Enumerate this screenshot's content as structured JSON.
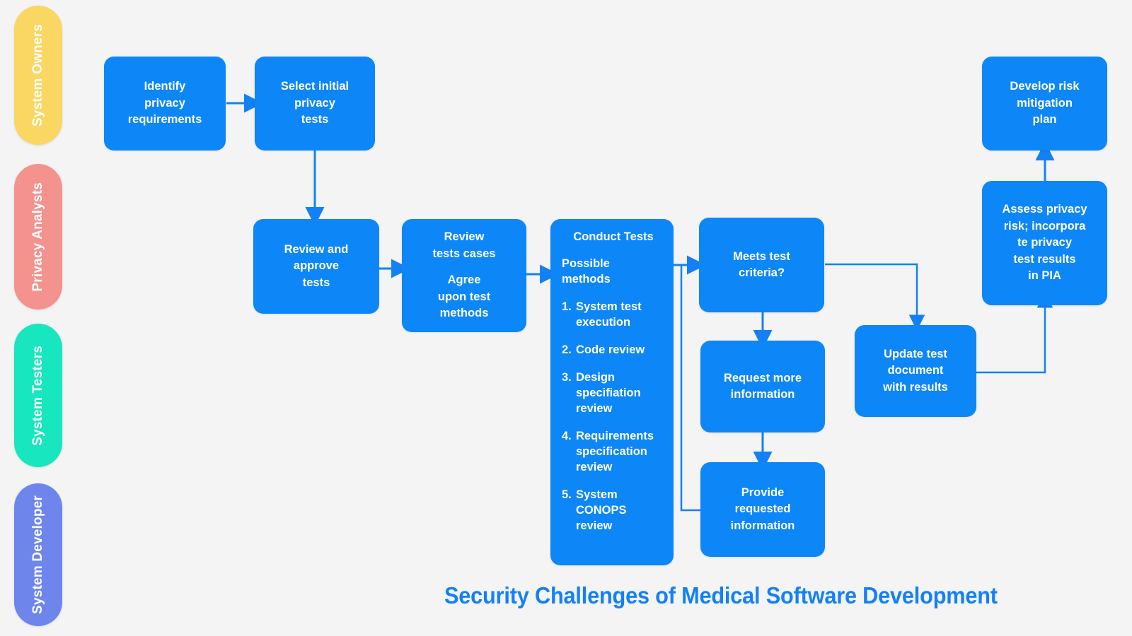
{
  "page": {
    "background_color": "#f4f4f4",
    "title": "Security Challenges of Medical Software Development",
    "title_color": "#1480f5"
  },
  "lanes": [
    {
      "id": "system-owners",
      "label": "System Owners",
      "color": "#FAD662"
    },
    {
      "id": "privacy-analysts",
      "label": "Privacy Analysts",
      "color": "#F4928E"
    },
    {
      "id": "system-testers",
      "label": "System Testers",
      "color": "#17E6BE"
    },
    {
      "id": "system-developer",
      "label": "System Developer",
      "color": "#6E85EC"
    }
  ],
  "node_color": "#0d86f8",
  "connector_color": "#1480f5",
  "nodes": {
    "identify_privacy_requirements": {
      "lines": [
        "Identify",
        "privacy",
        "requirements"
      ]
    },
    "select_initial_privacy_tests": {
      "lines": [
        "Select  initial",
        "privacy",
        "tests"
      ]
    },
    "review_and_approve_tests": {
      "lines": [
        "Review and",
        "approve",
        "tests"
      ]
    },
    "review_tests_cases": {
      "group_a": [
        "Review",
        "tests cases"
      ],
      "group_b": [
        "Agree",
        "upon test",
        "methods"
      ]
    },
    "conduct_tests": {
      "title": "Conduct Tests",
      "subtitle_lines": [
        "Possible",
        "methods"
      ],
      "methods": [
        {
          "num": "1.",
          "text": "System test execution"
        },
        {
          "num": "2.",
          "text": "Code review"
        },
        {
          "num": "3.",
          "text": "Design specifiation review"
        },
        {
          "num": "4.",
          "text": "Requirements specification review"
        },
        {
          "num": "5.",
          "text": "System CONOPS review"
        }
      ]
    },
    "meets_test_criteria": {
      "lines": [
        "Meets test",
        "criteria?"
      ]
    },
    "request_more_information": {
      "lines": [
        "Request more",
        "information"
      ]
    },
    "provide_requested_information": {
      "lines": [
        "Provide",
        "requested",
        "information"
      ]
    },
    "update_test_document": {
      "lines": [
        "Update test",
        "document",
        "with results"
      ]
    },
    "assess_privacy_risk": {
      "lines": [
        "Assess privacy",
        "risk; incorpora",
        "te privacy",
        "test results",
        "in PIA"
      ]
    },
    "develop_risk_mitigation_plan": {
      "lines": [
        "Develop risk",
        "mitigation",
        "plan"
      ]
    }
  }
}
